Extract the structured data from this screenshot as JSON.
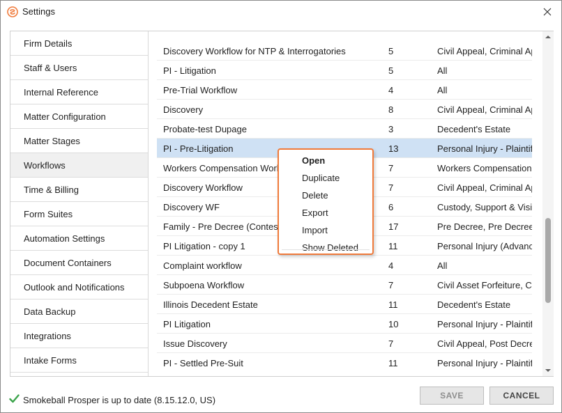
{
  "window": {
    "title": "Settings"
  },
  "sidebar": {
    "items": [
      {
        "label": "Firm Details",
        "active": false
      },
      {
        "label": "Staff & Users",
        "active": false
      },
      {
        "label": "Internal Reference",
        "active": false
      },
      {
        "label": "Matter Configuration",
        "active": false
      },
      {
        "label": "Matter Stages",
        "active": false
      },
      {
        "label": "Workflows",
        "active": true
      },
      {
        "label": "Time & Billing",
        "active": false
      },
      {
        "label": "Form Suites",
        "active": false
      },
      {
        "label": "Automation Settings",
        "active": false
      },
      {
        "label": "Document Containers",
        "active": false
      },
      {
        "label": "Outlook and Notifications",
        "active": false
      },
      {
        "label": "Data Backup",
        "active": false
      },
      {
        "label": "Integrations",
        "active": false
      },
      {
        "label": "Intake Forms",
        "active": false
      }
    ]
  },
  "workflows": {
    "rows": [
      {
        "name": "Discovery Workflow for NTP & Interrogatories",
        "count": "5",
        "type": "Civil Appeal, Criminal Ap",
        "selected": false
      },
      {
        "name": "PI - Litigation",
        "count": "5",
        "type": "All",
        "selected": false
      },
      {
        "name": "Pre-Trial Workflow",
        "count": "4",
        "type": "All",
        "selected": false
      },
      {
        "name": "Discovery",
        "count": "8",
        "type": "Civil Appeal, Criminal Ap",
        "selected": false
      },
      {
        "name": "Probate-test Dupage",
        "count": "3",
        "type": "Decedent's Estate",
        "selected": false
      },
      {
        "name": "PI - Pre-Litigation",
        "count": "13",
        "type": "Personal Injury - Plaintif",
        "selected": true
      },
      {
        "name": "Workers Compensation Work",
        "count": "7",
        "type": "Workers Compensation",
        "selected": false
      },
      {
        "name": "Discovery Workflow",
        "count": "7",
        "type": "Civil Appeal, Criminal Ap",
        "selected": false
      },
      {
        "name": "Discovery WF",
        "count": "6",
        "type": "Custody, Support & Visi",
        "selected": false
      },
      {
        "name": "Family - Pre Decree (Conteste",
        "count": "17",
        "type": "Pre Decree, Pre Decree",
        "selected": false
      },
      {
        "name": "PI Litigation - copy 1",
        "count": "11",
        "type": "Personal Injury (Advance",
        "selected": false
      },
      {
        "name": "Complaint workflow",
        "count": "4",
        "type": "All",
        "selected": false
      },
      {
        "name": "Subpoena Workflow",
        "count": "7",
        "type": "Civil Asset Forfeiture, Civ",
        "selected": false
      },
      {
        "name": "Illinois Decedent Estate",
        "count": "11",
        "type": "Decedent's Estate",
        "selected": false
      },
      {
        "name": "PI Litigation",
        "count": "10",
        "type": "Personal Injury - Plaintif",
        "selected": false
      },
      {
        "name": "Issue Discovery",
        "count": "7",
        "type": "Civil Appeal, Post Decre",
        "selected": false
      },
      {
        "name": "PI - Settled Pre-Suit",
        "count": "11",
        "type": "Personal Injury - Plaintif",
        "selected": false
      }
    ]
  },
  "context_menu": {
    "items": [
      {
        "label": "Open",
        "default": true,
        "key": "open"
      },
      {
        "label": "Duplicate",
        "default": false,
        "key": "duplicate"
      },
      {
        "label": "Delete",
        "default": false,
        "key": "delete"
      },
      {
        "label": "Export",
        "default": false,
        "key": "export"
      },
      {
        "label": "Import",
        "default": false,
        "key": "import"
      },
      {
        "label": "Show Deleted",
        "default": false,
        "key": "show-deleted"
      }
    ]
  },
  "status": {
    "text": "Smokeball Prosper is up to date (8.15.12.0, US)",
    "icon": "checkmark-icon"
  },
  "buttons": {
    "save": "SAVE",
    "cancel": "CANCEL"
  },
  "colors": {
    "accent": "#f07a3a",
    "selection": "#cfe1f4",
    "status_ok": "#3aa34a"
  }
}
